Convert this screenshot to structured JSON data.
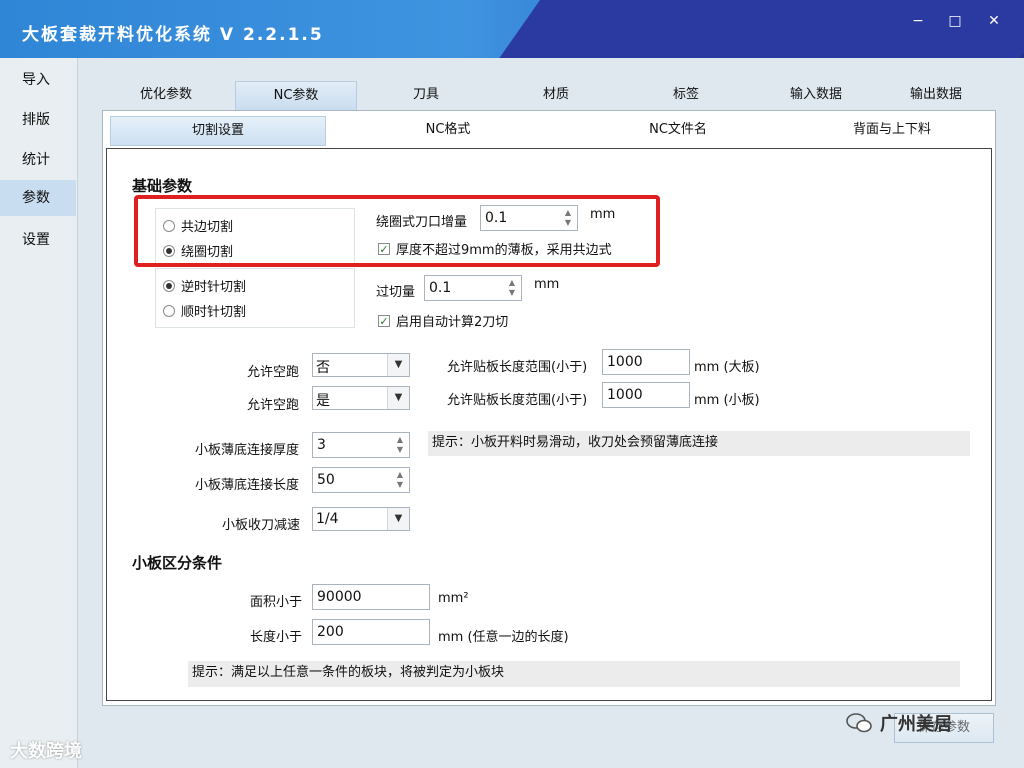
{
  "app": {
    "title": "大板套裁开料优化系统 V 2.2.1.5"
  },
  "window_controls": {
    "minimize": "−",
    "maximize": "□",
    "close": "✕"
  },
  "sidebar": {
    "items": [
      {
        "label": "导入"
      },
      {
        "label": "排版"
      },
      {
        "label": "统计"
      },
      {
        "label": "参数"
      },
      {
        "label": "设置"
      }
    ],
    "active": "参数"
  },
  "tabs": [
    {
      "label": "优化参数"
    },
    {
      "label": "NC参数"
    },
    {
      "label": "刀具"
    },
    {
      "label": "材质"
    },
    {
      "label": "标签"
    },
    {
      "label": "输入数据"
    },
    {
      "label": "输出数据"
    }
  ],
  "active_tab": "NC参数",
  "subtabs": [
    {
      "label": "切割设置"
    },
    {
      "label": "NC格式"
    },
    {
      "label": "NC文件名"
    },
    {
      "label": "背面与上下料"
    }
  ],
  "active_subtab": "切割设置",
  "basic": {
    "heading": "基础参数",
    "cut_mode": {
      "options": [
        "共边切割",
        "绕圈切割"
      ],
      "selected": "绕圈切割"
    },
    "direction": {
      "options": [
        "逆时针切割",
        "顺时针切割"
      ],
      "selected": "逆时针切割"
    },
    "kerf_increment": {
      "label": "绕圈式刀口增量",
      "value": "0.1",
      "unit": "mm"
    },
    "thin_board_check": {
      "label": "厚度不超过9mm的薄板，采用共边式",
      "checked": true
    },
    "overcut": {
      "label": "过切量",
      "value": "0.1",
      "unit": "mm"
    },
    "auto_two_pass": {
      "label": "启用自动计算2刀切",
      "checked": true
    },
    "allow_idle_1": {
      "label": "允许空跑",
      "value": "否"
    },
    "allow_idle_2": {
      "label": "允许空跑",
      "value": "是"
    },
    "paste_range_big": {
      "label": "允许贴板长度范围(小于)",
      "value": "1000",
      "unit": "mm (大板)"
    },
    "paste_range_small": {
      "label": "允许贴板长度范围(小于)",
      "value": "1000",
      "unit": "mm (小板)"
    },
    "bottom_thickness": {
      "label": "小板薄底连接厚度",
      "value": "3"
    },
    "bottom_length": {
      "label": "小板薄底连接长度",
      "value": "50"
    },
    "slowdown": {
      "label": "小板收刀减速",
      "value": "1/4"
    },
    "hint": "提示：小板开料时易滑动，收刀处会预留薄底连接"
  },
  "small_board": {
    "heading": "小板区分条件",
    "area": {
      "label": "面积小于",
      "value": "90000",
      "unit": "mm²"
    },
    "length": {
      "label": "长度小于",
      "value": "200",
      "unit": "mm (任意一边的长度)"
    },
    "hint": "提示：满足以上任意一条件的板块，将被判定为小板块"
  },
  "footer": {
    "save_label": "保存参数"
  },
  "watermarks": {
    "left": "大数跨境",
    "right": "广州美居"
  },
  "colors": {
    "titlebar": "#3f94e0",
    "highlight_box": "#e02020",
    "active_nav": "#c9ddf0"
  }
}
